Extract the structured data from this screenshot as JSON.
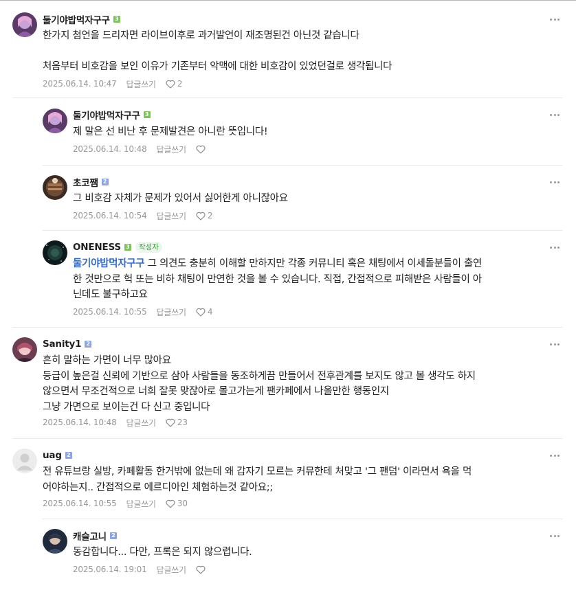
{
  "comments": [
    {
      "nick": "둘기야밥먹자구구",
      "level": "3",
      "lines": [
        "한가지 첨언을 드리자면 라이브이후로 과거발언이 재조명된건 아닌것 같습니다",
        "",
        "처음부터 비호감을 보인 이유가 기존부터 악맥에 대한 비호감이 있었던걸로 생각됩니다"
      ],
      "date": "2025.06.14. 10:47",
      "reply": "답글쓰기",
      "likes": "2"
    },
    {
      "nick": "둘기야밥먹자구구",
      "level": "3",
      "lines": [
        "제 말은 선 비난 후 문제발견은 아니란 뜻입니다!"
      ],
      "date": "2025.06.14. 10:48",
      "reply": "답글쓰기",
      "likes": ""
    },
    {
      "nick": "초코쨈",
      "level": "2",
      "lines": [
        "그 비호감 자체가 문제가 있어서 싫어한게 아니잖아요"
      ],
      "date": "2025.06.14. 10:54",
      "reply": "답글쓰기",
      "likes": "2"
    },
    {
      "nick": "ONENESS",
      "level": "3",
      "badge": "작성자",
      "mention": "둘기야밥먹자구구",
      "line1_rest": " 그 의견도 충분히 이해할 만하지만 각종 커뮤니티 혹은 채팅에서 이세돌분들이 출연",
      "lines": [
        "한 것만으로 헉 또는 비하 채팅이 만연한 것을 볼 수 있습니다. 직접, 간접적으로 피해받은 사람들이 아",
        "닌데도 불구하고요"
      ],
      "date": "2025.06.14. 10:55",
      "reply": "답글쓰기",
      "likes": "4"
    },
    {
      "nick": "Sanity1",
      "level": "2",
      "lines": [
        "흔히 말하는 가면이 너무 많아요",
        "등급이 높은걸 신뢰에 기반으로 삼아 사람들을 동조하게끔 만들어서 전후관계를 보지도 않고 볼 생각도 하지",
        "않으면서 무조건적으로 너희 잘못 맞잖아로 몰고가는게 팬카페에서 나올만한 행동인지",
        "그냥 가면으로 보이는건 다 신고 중입니다"
      ],
      "date": "2025.06.14. 10:48",
      "reply": "답글쓰기",
      "likes": "23"
    },
    {
      "nick": "uag",
      "level": "2",
      "lines": [
        "전 유튜브랑 실방, 카페활동 한거밖에 없는데 왜 갑자기 모르는 커뮤한테 처맞고 '그 팬덤' 이라면서 욕을 먹",
        "어야하는지.. 간접적으로 에르디아인 체험하는것 같아요;;"
      ],
      "date": "2025.06.14. 10:55",
      "reply": "답글쓰기",
      "likes": "30"
    },
    {
      "nick": "캐슬고니",
      "level": "2",
      "lines": [
        "동감합니다... 다만, 프록은 되지 않으렵니다."
      ],
      "date": "2025.06.14. 19:01",
      "reply": "답글쓰기",
      "likes": ""
    }
  ],
  "colors": {
    "level3": "#7dc35b",
    "level2": "#8aa4e8",
    "mention": "#2e6bd6",
    "writer_badge": "#35a335",
    "meta_text": "#979797"
  },
  "icons": {
    "more": "more-dots-icon",
    "like": "heart-outline-icon"
  }
}
